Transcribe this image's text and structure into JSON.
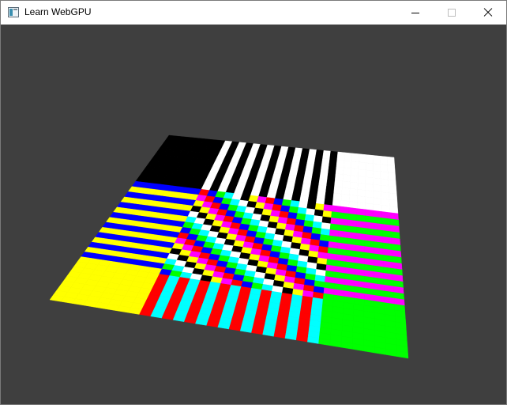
{
  "window": {
    "title": "Learn WebGPU",
    "app_icon": "window-app-icon",
    "controls": {
      "minimize": "minimize-icon",
      "maximize": "maximize-icon",
      "close": "close-icon"
    }
  },
  "scene": {
    "background_color": "#3f3f3f",
    "colors": {
      "black": "#000000",
      "white": "#ffffff",
      "yellow": "#ffff00",
      "blue": "#0000ff",
      "red": "#ff0000",
      "cyan": "#00ffff",
      "green": "#00ff00",
      "magenta": "#ff00ff"
    }
  }
}
